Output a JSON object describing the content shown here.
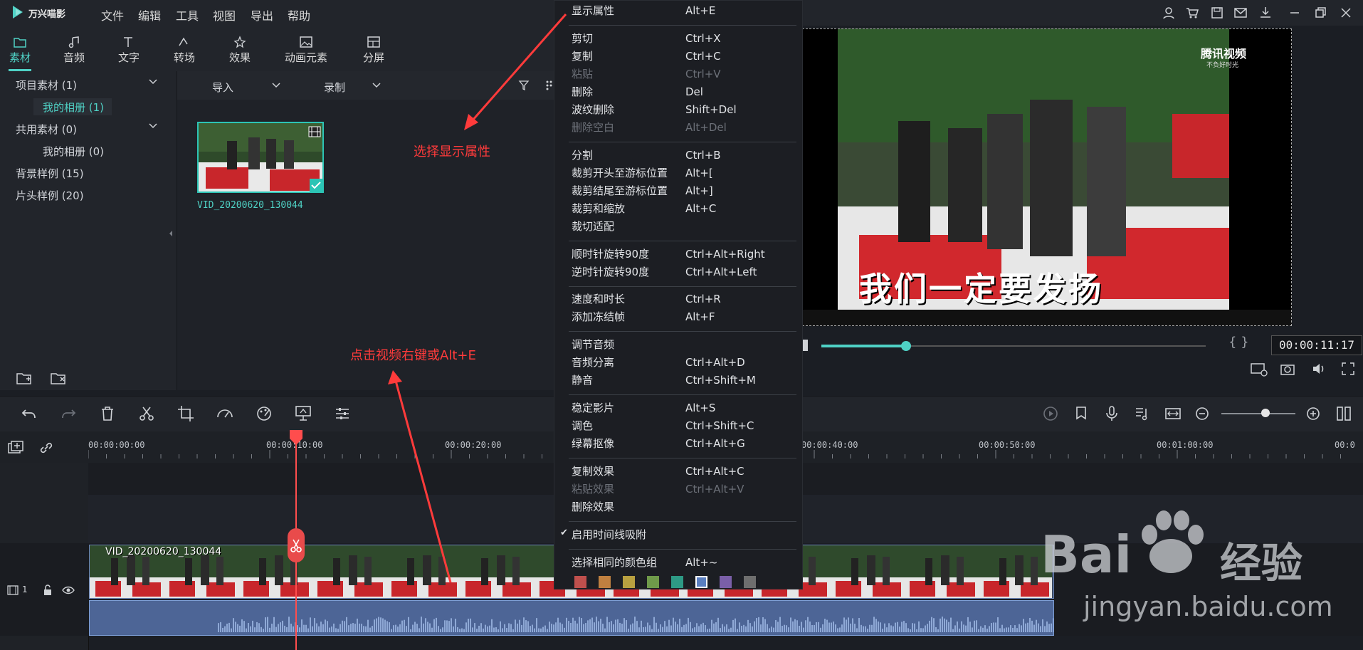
{
  "app": {
    "name": "万兴喵影"
  },
  "menubar": [
    "文件",
    "编辑",
    "工具",
    "视图",
    "导出",
    "帮助"
  ],
  "category_tabs": [
    "素材",
    "音频",
    "文字",
    "转场",
    "效果",
    "动画元素",
    "分屏"
  ],
  "tree": {
    "project": "项目素材 (1)",
    "project_album": "我的相册 (1)",
    "shared": "共用素材 (0)",
    "shared_album": "我的相册 (0)",
    "bg": "背景样例 (15)",
    "intro": "片头样例 (20)"
  },
  "mediabar": {
    "import": "导入",
    "record": "录制"
  },
  "media": {
    "clip_name": "VID_20200620_130044"
  },
  "preview": {
    "timecode": "00:00:11:17",
    "progress": 0.22
  },
  "ruler": {
    "labels": [
      "00:00:00:00",
      "00:00:10:00",
      "00:00:20:00",
      "00:00:40:00",
      "00:00:50:00",
      "00:01:00:00",
      "00:0"
    ]
  },
  "track": {
    "number": "1",
    "clip_title": "VID_20200620_130044"
  },
  "context_menu": {
    "items": [
      {
        "label": "显示属性",
        "shortcut": "Alt+E",
        "disabled": false
      },
      {
        "label": "剪切",
        "shortcut": "Ctrl+X",
        "disabled": false
      },
      {
        "label": "复制",
        "shortcut": "Ctrl+C",
        "disabled": false
      },
      {
        "label": "粘贴",
        "shortcut": "Ctrl+V",
        "disabled": true
      },
      {
        "label": "删除",
        "shortcut": "Del",
        "disabled": false
      },
      {
        "label": "波纹删除",
        "shortcut": "Shift+Del",
        "disabled": false
      },
      {
        "label": "删除空白",
        "shortcut": "Alt+Del",
        "disabled": true
      },
      {
        "label": "分割",
        "shortcut": "Ctrl+B",
        "disabled": false
      },
      {
        "label": "裁剪开头至游标位置",
        "shortcut": "Alt+[",
        "disabled": false
      },
      {
        "label": "裁剪结尾至游标位置",
        "shortcut": "Alt+]",
        "disabled": false
      },
      {
        "label": "裁剪和缩放",
        "shortcut": "Alt+C",
        "disabled": false
      },
      {
        "label": "裁切适配",
        "shortcut": "",
        "disabled": false
      },
      {
        "label": "顺时针旋转90度",
        "shortcut": "Ctrl+Alt+Right",
        "disabled": false
      },
      {
        "label": "逆时针旋转90度",
        "shortcut": "Ctrl+Alt+Left",
        "disabled": false
      },
      {
        "label": "速度和时长",
        "shortcut": "Ctrl+R",
        "disabled": false
      },
      {
        "label": "添加冻结帧",
        "shortcut": "Alt+F",
        "disabled": false
      },
      {
        "label": "调节音频",
        "shortcut": "",
        "disabled": false
      },
      {
        "label": "音频分离",
        "shortcut": "Ctrl+Alt+D",
        "disabled": false
      },
      {
        "label": "静音",
        "shortcut": "Ctrl+Shift+M",
        "disabled": false
      },
      {
        "label": "稳定影片",
        "shortcut": "Alt+S",
        "disabled": false
      },
      {
        "label": "调色",
        "shortcut": "Ctrl+Shift+C",
        "disabled": false
      },
      {
        "label": "绿幕抠像",
        "shortcut": "Ctrl+Alt+G",
        "disabled": false
      },
      {
        "label": "复制效果",
        "shortcut": "Ctrl+Alt+C",
        "disabled": false
      },
      {
        "label": "粘贴效果",
        "shortcut": "Ctrl+Alt+V",
        "disabled": true
      },
      {
        "label": "删除效果",
        "shortcut": "",
        "disabled": false
      },
      {
        "label": "启用时间线吸附",
        "shortcut": "",
        "disabled": false,
        "checked": true
      },
      {
        "label": "选择相同的颜色组",
        "shortcut": "Alt+~",
        "disabled": false
      }
    ],
    "color_swatches": [
      "#c0504d",
      "#c08040",
      "#b8a040",
      "#6f9a4a",
      "#2e9a85",
      "#5b7fc0",
      "#7a5fa8",
      "#6e6e6e"
    ]
  },
  "annotations": {
    "select_props": "选择显示属性",
    "right_click": "点击视频右键或Alt+E"
  },
  "video_overlay": {
    "brand": "腾讯视频",
    "brand_sub": "不负好时光",
    "subtitle": "我们一定要发扬"
  },
  "watermark": {
    "line1": "Bai",
    "line2": "经验",
    "url": "jingyan.baidu.com"
  }
}
